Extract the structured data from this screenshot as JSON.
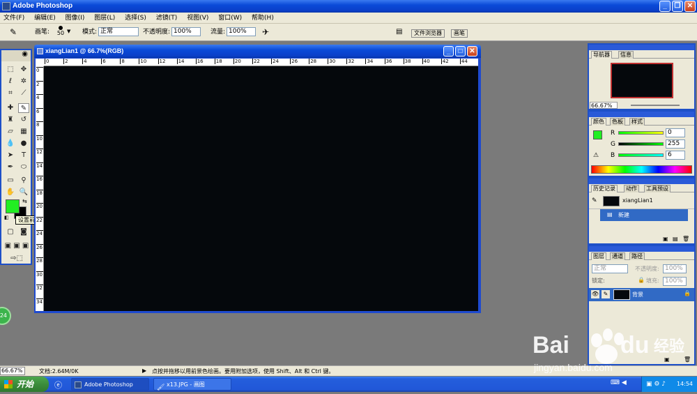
{
  "app": {
    "title": "Adobe Photoshop"
  },
  "menu": [
    "文件(F)",
    "编辑(E)",
    "图像(I)",
    "图层(L)",
    "选择(S)",
    "滤镜(T)",
    "视图(V)",
    "窗口(W)",
    "帮助(H)"
  ],
  "options": {
    "brush_label": "画笔:",
    "brush_size": "50",
    "mode_label": "模式:",
    "mode_value": "正常",
    "opacity_label": "不透明度:",
    "opacity_value": "100%",
    "flow_label": "流量:",
    "flow_value": "100%",
    "dock_tabs": [
      "文件浏览器",
      "画笔"
    ]
  },
  "toolbox": {
    "foreground_color": "#22ee22",
    "background_color": "#000000",
    "tooltip": "设置前景色"
  },
  "document": {
    "title": "xiangLian1 @ 66.7%(RGB)",
    "canvas_color": "#05080c",
    "ruler_h": [
      "0",
      "2",
      "4",
      "6",
      "8",
      "10",
      "12",
      "14",
      "16",
      "18",
      "20",
      "22",
      "24",
      "26",
      "28",
      "30",
      "32",
      "34",
      "36",
      "38",
      "40",
      "42",
      "44"
    ],
    "ruler_v": [
      "0",
      "2",
      "4",
      "6",
      "8",
      "10",
      "12",
      "14",
      "16",
      "18",
      "20",
      "22",
      "24",
      "26",
      "28",
      "30",
      "32",
      "34"
    ]
  },
  "navigator": {
    "tabs": [
      "导航器",
      "信息"
    ],
    "zoom": "66.67%"
  },
  "color_panel": {
    "tabs": [
      "颜色",
      "色板",
      "样式"
    ],
    "channels": [
      {
        "label": "R",
        "value": "0"
      },
      {
        "label": "G",
        "value": "255"
      },
      {
        "label": "B",
        "value": "6"
      }
    ]
  },
  "history": {
    "tabs": [
      "历史记录",
      "动作",
      "工具预设"
    ],
    "snapshot": "xiangLian1",
    "items": [
      "新建"
    ]
  },
  "layers": {
    "tabs": [
      "图层",
      "通道",
      "路径"
    ],
    "blend": "正常",
    "opacity_label": "不透明度:",
    "opacity_value": "100%",
    "lock_label": "锁定:",
    "fill_label": "填充:",
    "fill_value": "100%",
    "layer_name": "背景"
  },
  "status": {
    "zoom": "66.67%",
    "doc": "文档:2.64M/0K",
    "hint": "点按并拖移以用前景色绘画。要用附加选项，使用 Shift、Alt 和 Ctrl 键。"
  },
  "taskbar": {
    "start": "开始",
    "tasks": [
      "Adobe Photoshop",
      "x13.JPG - 画图"
    ],
    "clock": "14:54"
  },
  "badge": "24",
  "watermark": {
    "logo": "Baidu经验",
    "url": "jingyan.baidu.com"
  }
}
